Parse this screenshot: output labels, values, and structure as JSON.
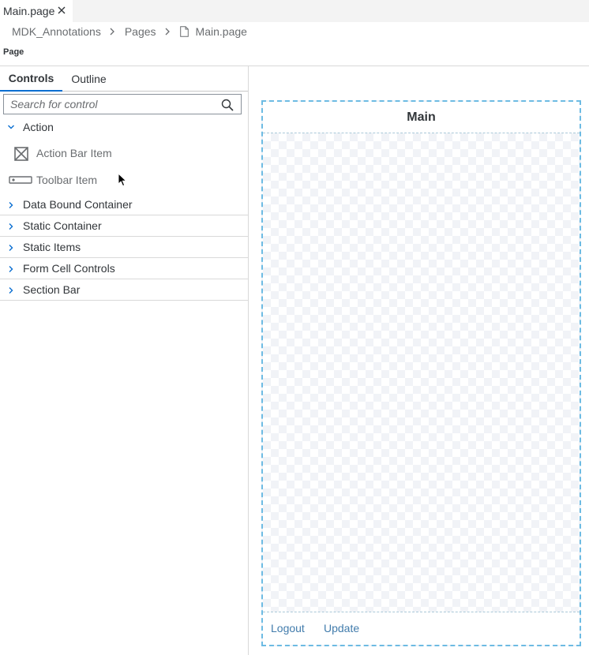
{
  "tab": {
    "label": "Main.page"
  },
  "breadcrumb": {
    "items": [
      "MDK_Annotations",
      "Pages",
      "Main.page"
    ]
  },
  "page_label": "Page",
  "panel": {
    "tabs": [
      "Controls",
      "Outline"
    ],
    "search_placeholder": "Search for control",
    "groups": [
      {
        "label": "Action",
        "expanded": true,
        "items": [
          {
            "label": "Action Bar Item",
            "icon": "action-bar-item-icon"
          },
          {
            "label": "Toolbar Item",
            "icon": "toolbar-item-icon"
          }
        ]
      },
      {
        "label": "Data Bound Container",
        "expanded": false
      },
      {
        "label": "Static Container",
        "expanded": false
      },
      {
        "label": "Static Items",
        "expanded": false
      },
      {
        "label": "Form Cell Controls",
        "expanded": false
      },
      {
        "label": "Section Bar",
        "expanded": false
      }
    ]
  },
  "canvas": {
    "title": "Main",
    "toolbar": [
      "Logout",
      "Update"
    ]
  },
  "colors": {
    "accent": "#0a6ed1",
    "canvas_border": "#6dbbe3",
    "toolbar_link": "#427cac"
  }
}
